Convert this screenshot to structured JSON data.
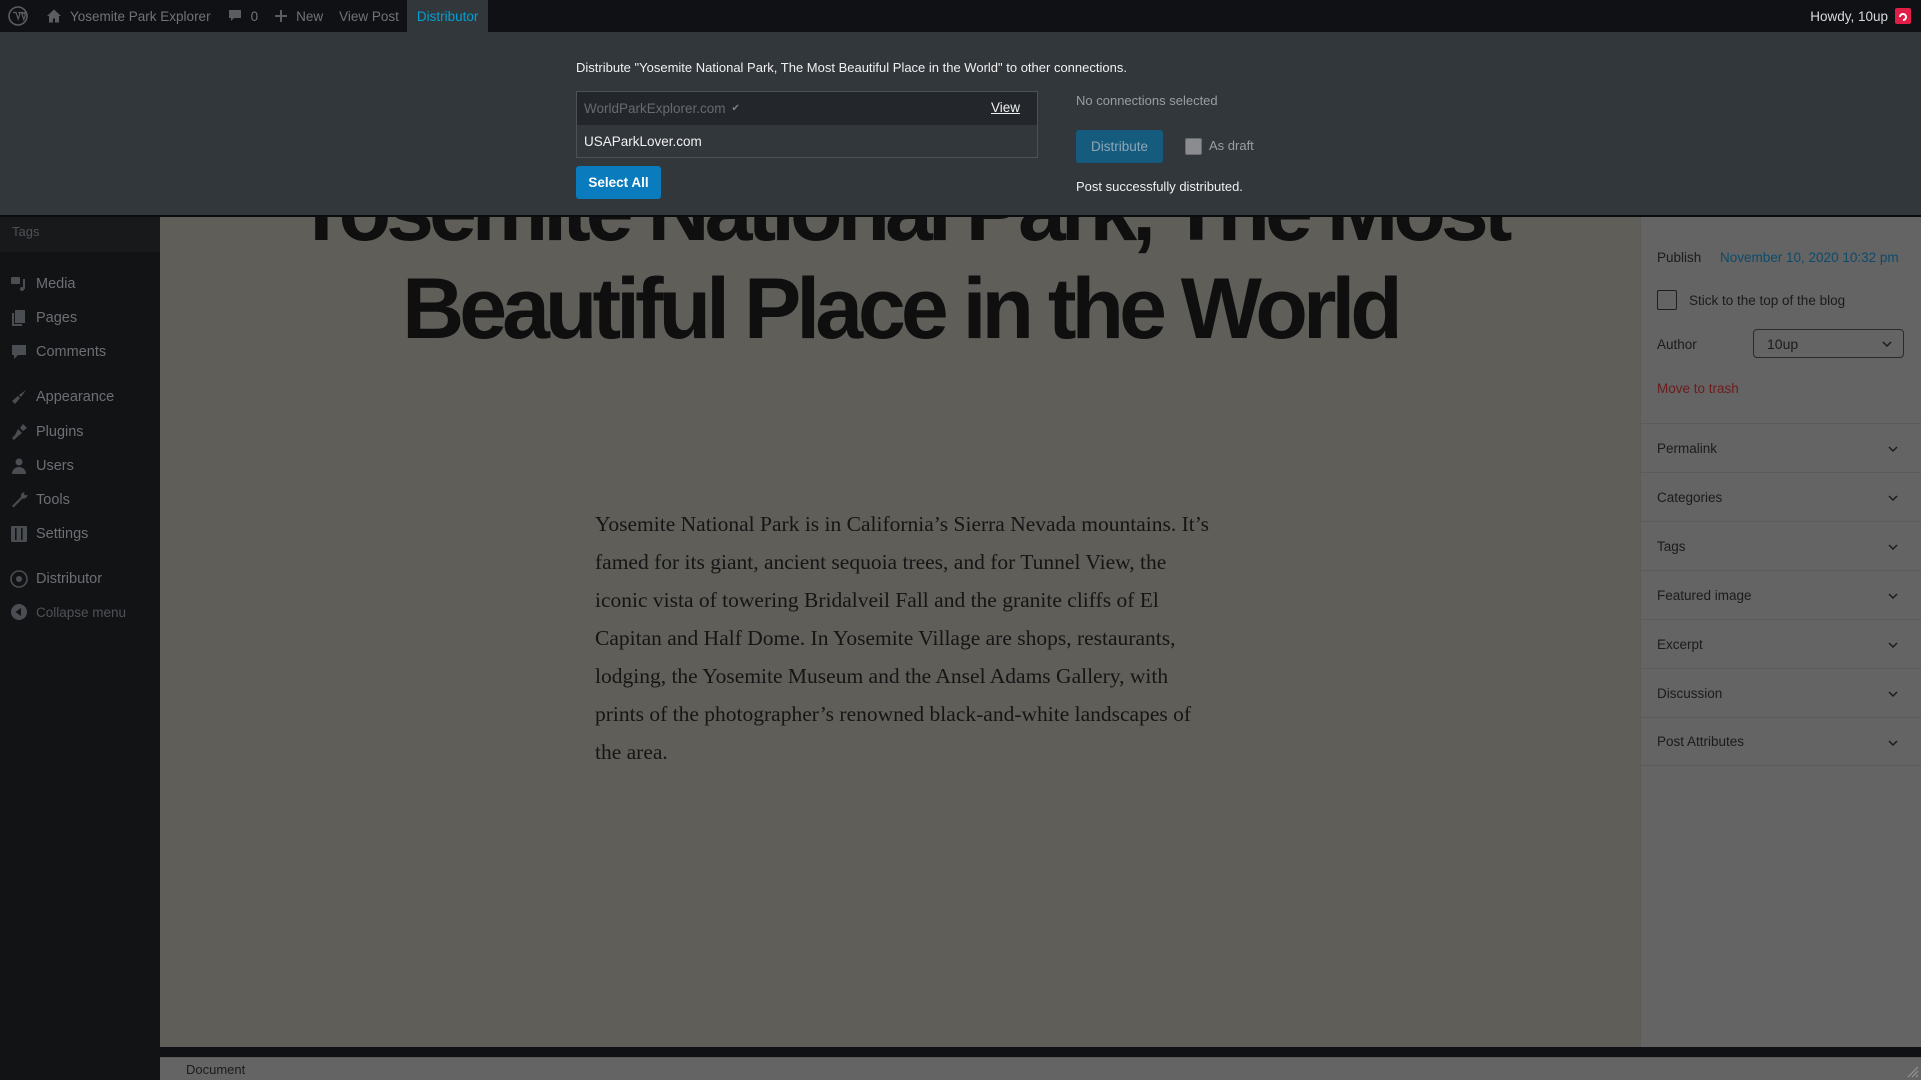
{
  "adminbar": {
    "site_name": "Yosemite Park Explorer",
    "comments_count": "0",
    "new_label": "New",
    "view_post_label": "View Post",
    "distributor_label": "Distributor",
    "howdy": "Howdy, 10up",
    "accent_color": "#00a0d2"
  },
  "sidebar": {
    "submenu_item": "Tags",
    "items": [
      {
        "label": "Media",
        "icon": "media-icon"
      },
      {
        "label": "Pages",
        "icon": "pages-icon"
      },
      {
        "label": "Comments",
        "icon": "comments-icon"
      },
      {
        "label": "Appearance",
        "icon": "appearance-icon"
      },
      {
        "label": "Plugins",
        "icon": "plugins-icon"
      },
      {
        "label": "Users",
        "icon": "users-icon"
      },
      {
        "label": "Tools",
        "icon": "tools-icon"
      },
      {
        "label": "Settings",
        "icon": "settings-icon"
      },
      {
        "label": "Distributor",
        "icon": "distributor-icon"
      }
    ],
    "collapse_label": "Collapse menu"
  },
  "distributor": {
    "title": "Distribute \"Yosemite National Park, The Most Beautiful Place in the World\" to other connections.",
    "connections": [
      {
        "name": "WorldParkExplorer.com",
        "distributed": true,
        "view_label": "View"
      },
      {
        "name": "USAParkLover.com",
        "distributed": false
      }
    ],
    "select_all_label": "Select All",
    "selected_status": "No connections selected",
    "distribute_label": "Distribute",
    "as_draft_label": "As draft",
    "as_draft_checked": false,
    "success_message": "Post successfully distributed."
  },
  "post": {
    "title": "Yosemite National Park, The Most Beautiful Place in the World",
    "body": "Yosemite National Park is in California’s Sierra Nevada mountains. It’s famed for its giant, ancient sequoia trees, and for Tunnel View, the iconic vista of towering Bridalveil Fall and the granite cliffs of El Capitan and Half Dome. In Yosemite Village are shops, restaurants, lodging, the Yosemite Museum and the Ansel Adams Gallery, with prints of the photographer’s renowned black-and-white landscapes of the area."
  },
  "settings": {
    "publish_label": "Publish",
    "publish_date": "November 10, 2020 10:32 pm",
    "sticky_label": "Stick to the top of the blog",
    "sticky_checked": false,
    "author_label": "Author",
    "author_value": "10up",
    "trash_label": "Move to trash",
    "panels": [
      "Permalink",
      "Categories",
      "Tags",
      "Featured image",
      "Excerpt",
      "Discussion",
      "Post Attributes"
    ]
  },
  "footer": {
    "breadcrumb": "Document"
  }
}
